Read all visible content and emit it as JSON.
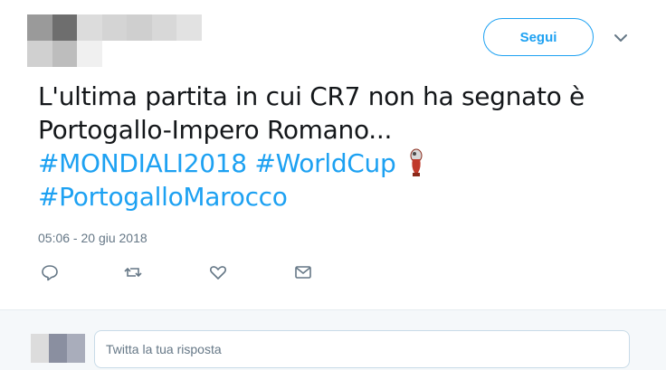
{
  "header": {
    "follow_label": "Segui",
    "avatar_icon": "blurred-profile-avatar"
  },
  "tweet": {
    "text_line1": "L'ultima partita in cui CR7 non ha segnato è",
    "text_line2": "Portogallo-Impero Romano...",
    "hashtag1": "#MONDIALI2018",
    "hashtag2": "#WorldCup",
    "hashtag3": "#PortogalloMarocco",
    "emoji": "world-cup-trophy-icon",
    "timestamp": "05:06 - 20 giu 2018"
  },
  "actions": {
    "reply_icon": "reply-icon",
    "retweet_icon": "retweet-icon",
    "like_icon": "heart-icon",
    "message_icon": "envelope-icon"
  },
  "reply": {
    "placeholder": "Twitta la tua risposta"
  },
  "colors": {
    "accent": "#1da1f2",
    "text": "#14171a",
    "muted": "#657786",
    "reply_bg": "#f5f8fa"
  }
}
